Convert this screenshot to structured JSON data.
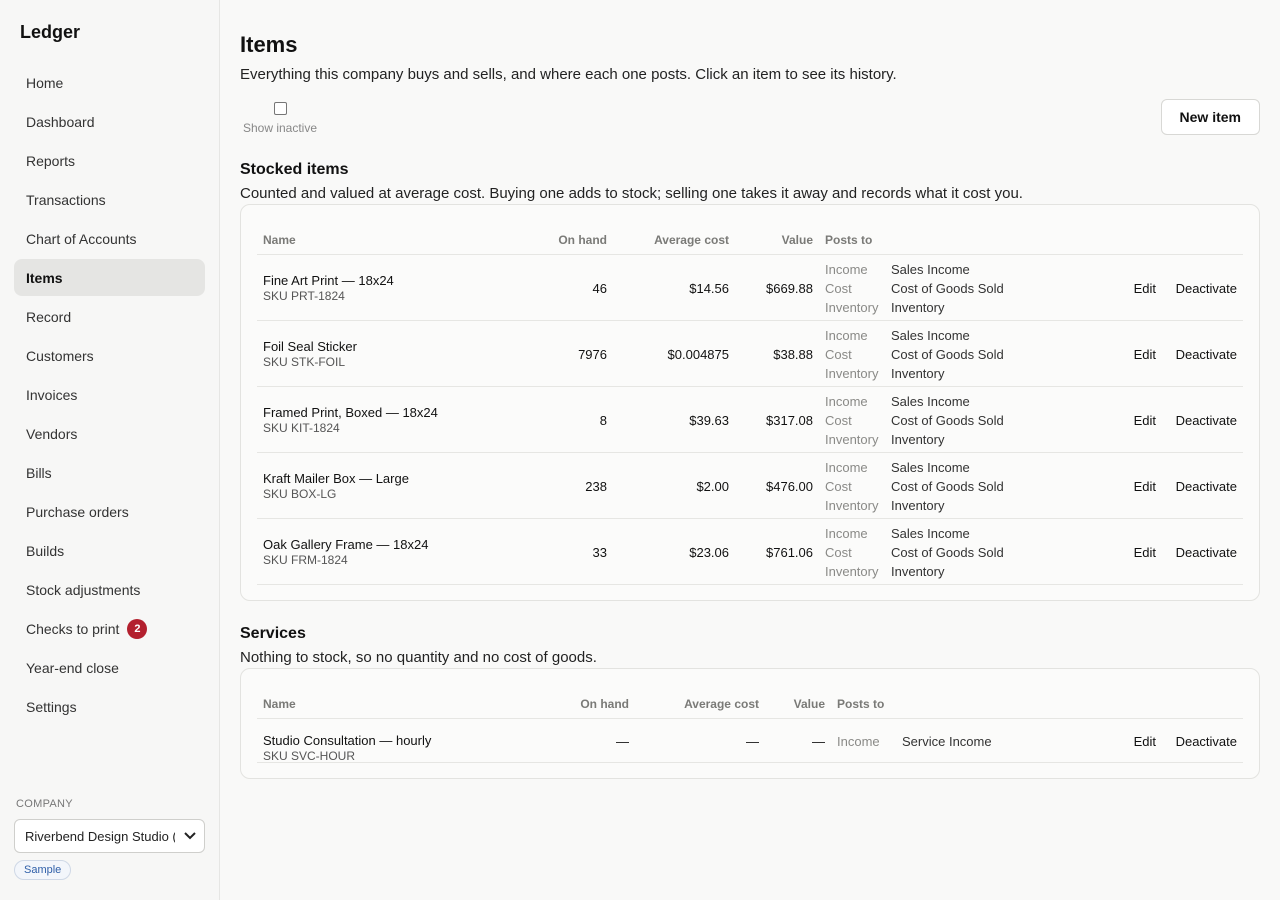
{
  "sidebar": {
    "brand": "Ledger",
    "items": [
      {
        "label": "Home"
      },
      {
        "label": "Dashboard"
      },
      {
        "label": "Reports"
      },
      {
        "label": "Transactions"
      },
      {
        "label": "Chart of Accounts"
      },
      {
        "label": "Items"
      },
      {
        "label": "Record"
      },
      {
        "label": "Customers"
      },
      {
        "label": "Invoices"
      },
      {
        "label": "Vendors"
      },
      {
        "label": "Bills"
      },
      {
        "label": "Purchase orders"
      },
      {
        "label": "Builds"
      },
      {
        "label": "Stock adjustments"
      },
      {
        "label": "Checks to print",
        "badge": "2"
      },
      {
        "label": "Year-end close"
      },
      {
        "label": "Settings"
      }
    ],
    "active": "Items",
    "company_label": "COMPANY",
    "company_value": "Riverbend Design Studio (S",
    "sample_tag": "Sample"
  },
  "header": {
    "title": "Items",
    "subtitle": "Everything this company buys and sells, and where each one posts. Click an item to see its history.",
    "show_inactive_label": "Show inactive",
    "new_item_label": "New item"
  },
  "stocked": {
    "title": "Stocked items",
    "subtitle": "Counted and valued at average cost. Buying one adds to stock; selling one takes it away and records what it cost you.",
    "columns": {
      "name": "Name",
      "on_hand": "On hand",
      "avg_cost": "Average cost",
      "value": "Value",
      "posts_to": "Posts to"
    },
    "rows": [
      {
        "name": "Fine Art Print — 18x24",
        "sku": "SKU PRT-1824",
        "on_hand": "46",
        "avg_cost": "$14.56",
        "value": "$669.88",
        "posts": [
          {
            "label": "Income",
            "account": "Sales Income"
          },
          {
            "label": "Cost",
            "account": "Cost of Goods Sold"
          },
          {
            "label": "Inventory",
            "account": "Inventory"
          }
        ]
      },
      {
        "name": "Foil Seal Sticker",
        "sku": "SKU STK-FOIL",
        "on_hand": "7976",
        "avg_cost": "$0.004875",
        "value": "$38.88",
        "posts": [
          {
            "label": "Income",
            "account": "Sales Income"
          },
          {
            "label": "Cost",
            "account": "Cost of Goods Sold"
          },
          {
            "label": "Inventory",
            "account": "Inventory"
          }
        ]
      },
      {
        "name": "Framed Print, Boxed — 18x24",
        "sku": "SKU KIT-1824",
        "on_hand": "8",
        "avg_cost": "$39.63",
        "value": "$317.08",
        "posts": [
          {
            "label": "Income",
            "account": "Sales Income"
          },
          {
            "label": "Cost",
            "account": "Cost of Goods Sold"
          },
          {
            "label": "Inventory",
            "account": "Inventory"
          }
        ]
      },
      {
        "name": "Kraft Mailer Box — Large",
        "sku": "SKU BOX-LG",
        "on_hand": "238",
        "avg_cost": "$2.00",
        "value": "$476.00",
        "posts": [
          {
            "label": "Income",
            "account": "Sales Income"
          },
          {
            "label": "Cost",
            "account": "Cost of Goods Sold"
          },
          {
            "label": "Inventory",
            "account": "Inventory"
          }
        ]
      },
      {
        "name": "Oak Gallery Frame — 18x24",
        "sku": "SKU FRM-1824",
        "on_hand": "33",
        "avg_cost": "$23.06",
        "value": "$761.06",
        "posts": [
          {
            "label": "Income",
            "account": "Sales Income"
          },
          {
            "label": "Cost",
            "account": "Cost of Goods Sold"
          },
          {
            "label": "Inventory",
            "account": "Inventory"
          }
        ]
      }
    ]
  },
  "services": {
    "title": "Services",
    "subtitle": "Nothing to stock, so no quantity and no cost of goods.",
    "columns": {
      "name": "Name",
      "on_hand": "On hand",
      "avg_cost": "Average cost",
      "value": "Value",
      "posts_to": "Posts to"
    },
    "rows": [
      {
        "name": "Studio Consultation — hourly",
        "sku": "SKU SVC-HOUR",
        "on_hand": "—",
        "avg_cost": "—",
        "value": "—",
        "posts": [
          {
            "label": "Income",
            "account": "Service Income"
          }
        ]
      }
    ]
  },
  "actions": {
    "edit": "Edit",
    "deactivate": "Deactivate"
  }
}
